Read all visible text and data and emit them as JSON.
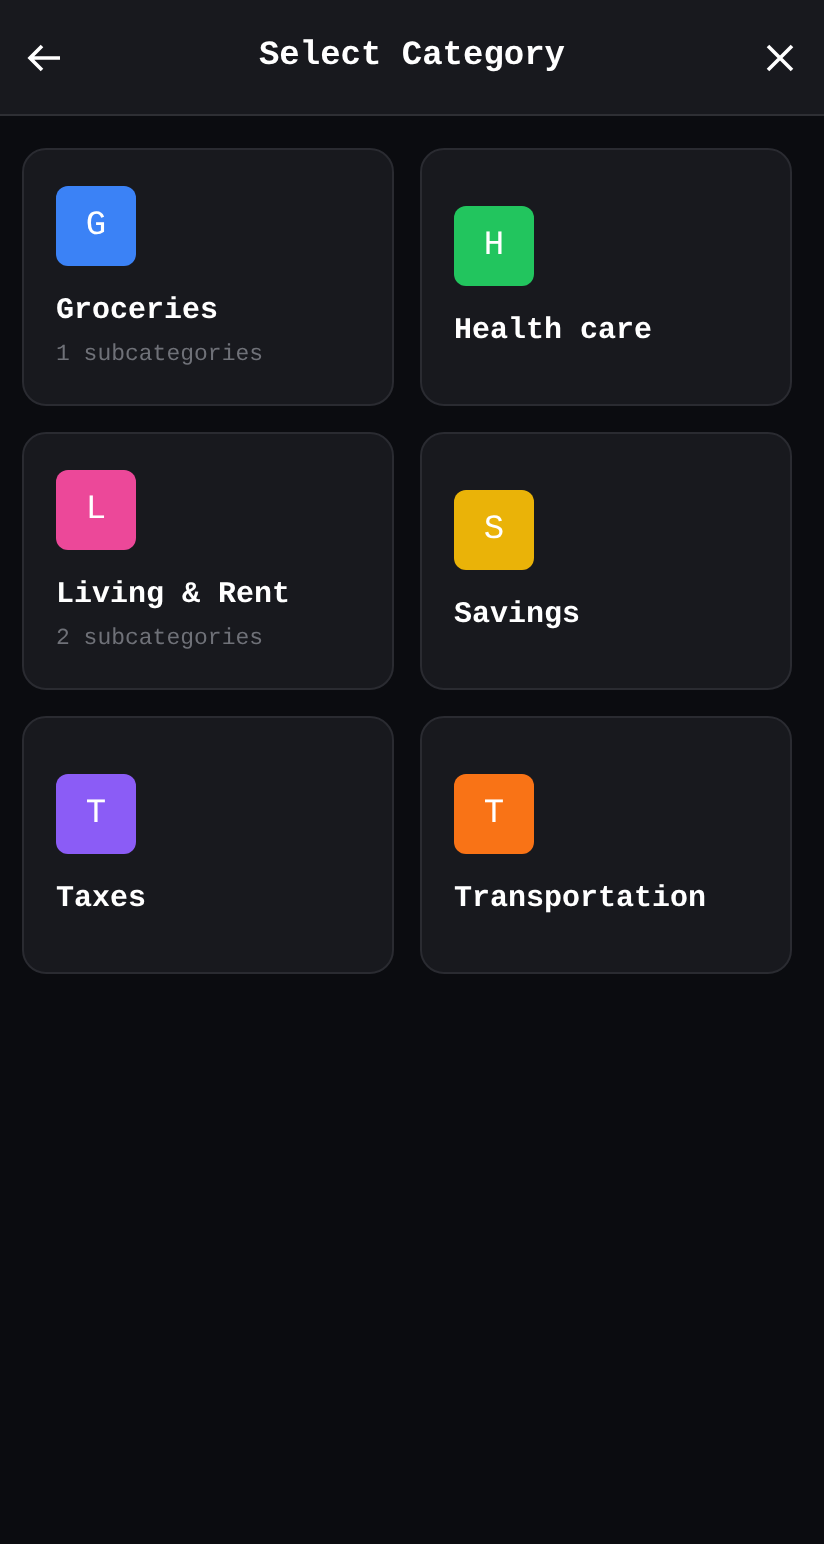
{
  "header": {
    "title": "Select Category"
  },
  "categories": [
    {
      "letter": "G",
      "name": "Groceries",
      "subtitle": "1 subcategories",
      "color": "#3b82f6"
    },
    {
      "letter": "H",
      "name": "Health care",
      "color": "#22c55e"
    },
    {
      "letter": "L",
      "name": "Living & Rent",
      "subtitle": "2 subcategories",
      "color": "#ec4899"
    },
    {
      "letter": "S",
      "name": "Savings",
      "color": "#eab308"
    },
    {
      "letter": "T",
      "name": "Taxes",
      "color": "#8b5cf6"
    },
    {
      "letter": "T",
      "name": "Transportation",
      "color": "#f97316"
    }
  ]
}
